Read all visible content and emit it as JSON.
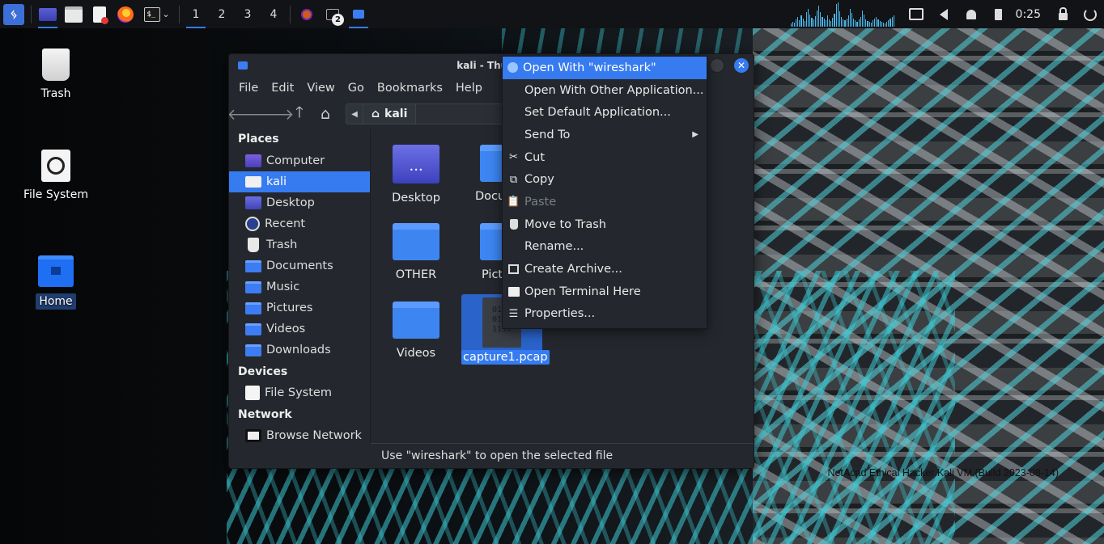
{
  "panel": {
    "workspaces": [
      "1",
      "2",
      "3",
      "4"
    ],
    "task_badge": "2",
    "clock": "0:25"
  },
  "desktop": {
    "icons": [
      {
        "label": "Trash"
      },
      {
        "label": "File System"
      },
      {
        "label": "Home"
      }
    ],
    "watermark": "NetAcad Ethical Hacker Kali VM (Build 2023-08-14)"
  },
  "window": {
    "title": "kali - Thunar",
    "menu": [
      "File",
      "Edit",
      "View",
      "Go",
      "Bookmarks",
      "Help"
    ],
    "path": [
      "kali"
    ],
    "sidebar": {
      "places_label": "Places",
      "places": [
        {
          "label": "Computer",
          "icon": "computer-icon"
        },
        {
          "label": "kali",
          "icon": "home-icon",
          "selected": true
        },
        {
          "label": "Desktop",
          "icon": "desktop-icon"
        },
        {
          "label": "Recent",
          "icon": "clock-icon"
        },
        {
          "label": "Trash",
          "icon": "trash-icon"
        },
        {
          "label": "Documents",
          "icon": "folder-documents-icon"
        },
        {
          "label": "Music",
          "icon": "folder-music-icon"
        },
        {
          "label": "Pictures",
          "icon": "folder-pictures-icon"
        },
        {
          "label": "Videos",
          "icon": "folder-videos-icon"
        },
        {
          "label": "Downloads",
          "icon": "folder-downloads-icon"
        }
      ],
      "devices_label": "Devices",
      "devices": [
        {
          "label": "File System",
          "icon": "drive-icon"
        }
      ],
      "network_label": "Network",
      "network": [
        {
          "label": "Browse Network",
          "icon": "network-icon"
        }
      ]
    },
    "files": [
      {
        "label": "Desktop"
      },
      {
        "label": "Docum"
      },
      {
        "label": "OTHER"
      },
      {
        "label": "Pict"
      },
      {
        "label": "Videos"
      },
      {
        "label": "capture1.pcap",
        "selected": true,
        "preview": "0101\n0110\n1110"
      }
    ],
    "status": "Use \"wireshark\" to open the selected file"
  },
  "context_menu": {
    "items": [
      {
        "label": "Open With \"wireshark\"",
        "icon": "wireshark-icon",
        "highlighted": true
      },
      {
        "label": "Open With Other Application...",
        "icon": ""
      },
      {
        "label": "Set Default Application...",
        "icon": ""
      },
      {
        "label": "Send To",
        "icon": "",
        "submenu": true
      },
      {
        "label": "Cut",
        "icon": "scissors-icon"
      },
      {
        "label": "Copy",
        "icon": "copy-icon"
      },
      {
        "label": "Paste",
        "icon": "paste-icon",
        "disabled": true
      },
      {
        "label": "Move to Trash",
        "icon": "trash-icon"
      },
      {
        "label": "Rename...",
        "icon": ""
      },
      {
        "label": "Create Archive...",
        "icon": "archive-icon"
      },
      {
        "label": "Open Terminal Here",
        "icon": "terminal-icon"
      },
      {
        "label": "Properties...",
        "icon": "properties-icon"
      }
    ]
  },
  "colors": {
    "accent": "#367bf0",
    "window_bg": "#24282e",
    "panel_bg": "#111317"
  }
}
